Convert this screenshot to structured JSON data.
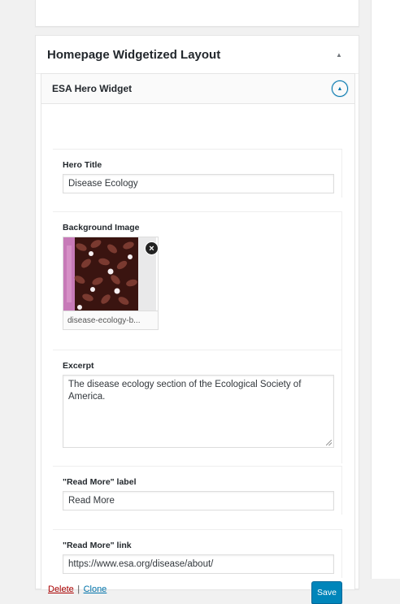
{
  "panel": {
    "title": "Homepage Widgetized Layout"
  },
  "widget": {
    "title": "ESA Hero Widget",
    "fields": {
      "hero_title": {
        "label": "Hero Title",
        "value": "Disease Ecology"
      },
      "background_image": {
        "label": "Background Image",
        "filename": "disease-ecology-b..."
      },
      "excerpt": {
        "label": "Excerpt",
        "value": "The disease ecology section of the Ecological Society of America."
      },
      "read_more_label": {
        "label": "\"Read More\" label",
        "value": "Read More"
      },
      "read_more_link": {
        "label": "\"Read More\" link",
        "value": "https://www.esa.org/disease/about/"
      }
    },
    "actions": {
      "delete": "Delete",
      "separator": "|",
      "clone": "Clone",
      "save": "Save"
    }
  },
  "icons": {
    "panel_toggle": "caret-up-icon",
    "widget_toggle": "circle-caret-up-icon",
    "remove_image": "close-icon"
  },
  "colors": {
    "accent": "#0073aa",
    "primary_button": "#0085ba",
    "delete_link": "#a00000"
  }
}
